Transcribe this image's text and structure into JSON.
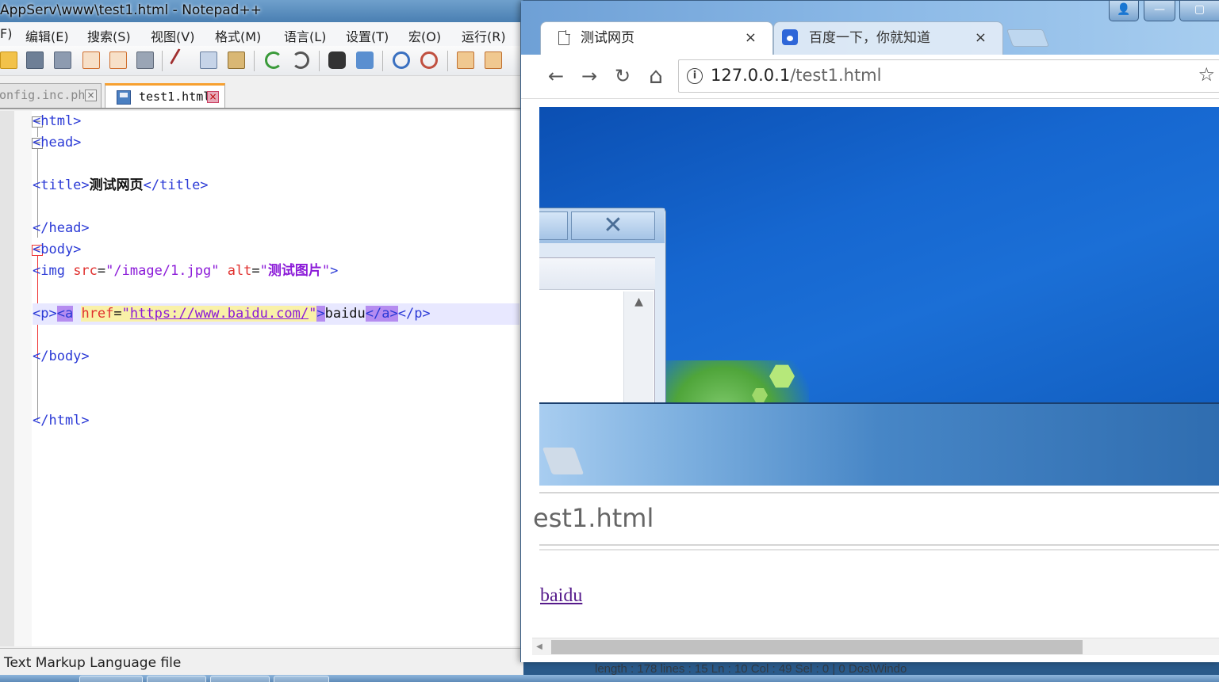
{
  "notepad": {
    "title": "AppServ\\www\\test1.html - Notepad++",
    "menu": [
      "F)",
      "编辑(E)",
      "搜索(S)",
      "视图(V)",
      "格式(M)",
      "语言(L)",
      "设置(T)",
      "宏(O)",
      "运行(R)"
    ],
    "tabs": [
      {
        "label": "onfig.inc.php",
        "active": false
      },
      {
        "label": "test1.html",
        "active": true
      }
    ],
    "code": {
      "l1": "<html>",
      "l2": "<head>",
      "l3_open": "<title>",
      "l3_text": "测试网页",
      "l3_close": "</title>",
      "l4": "</head>",
      "l5": "<body>",
      "l6_tag": "<img ",
      "l6_attr1": "src",
      "l6_eq1": "=",
      "l6_val1": "\"/image/1.jpg\"",
      "l6_attr2": "alt",
      "l6_eq2": "=",
      "l6_q1": "\"",
      "l6_val2": "测试图片",
      "l6_q2": "\"",
      "l6_end": ">",
      "l7_p": "<p>",
      "l7_a": "<a",
      "l7_href": "href",
      "l7_eq": "=",
      "l7_q1": "\"",
      "l7_url": "https://www.baidu.com/",
      "l7_q2": "\"",
      "l7_gt": ">",
      "l7_text": "baidu",
      "l7_aclose": "</a>",
      "l7_pclose": "</p>",
      "l8": "</body>",
      "l9": "</html>"
    },
    "status": "Text Markup Language file",
    "status_behind": "length : 178    lines : 15                Ln : 10    Col : 49    Sel : 0 | 0                     Dos\\Windo"
  },
  "chrome": {
    "tabs": [
      {
        "label": "测试网页",
        "close": "×"
      },
      {
        "label": "百度一下，你就知道",
        "close": "×"
      }
    ],
    "url_host": "127.0.0.1",
    "url_path": "/test1.html",
    "nav": {
      "back": "←",
      "forward": "→",
      "reload": "↻",
      "home": "⌂",
      "info": "i",
      "star": "☆"
    },
    "window_buttons": {
      "user": "👤",
      "minimize": "—",
      "maximize": "▢"
    },
    "page": {
      "image_address_text": "est1.html",
      "link_text": "baidu"
    }
  }
}
